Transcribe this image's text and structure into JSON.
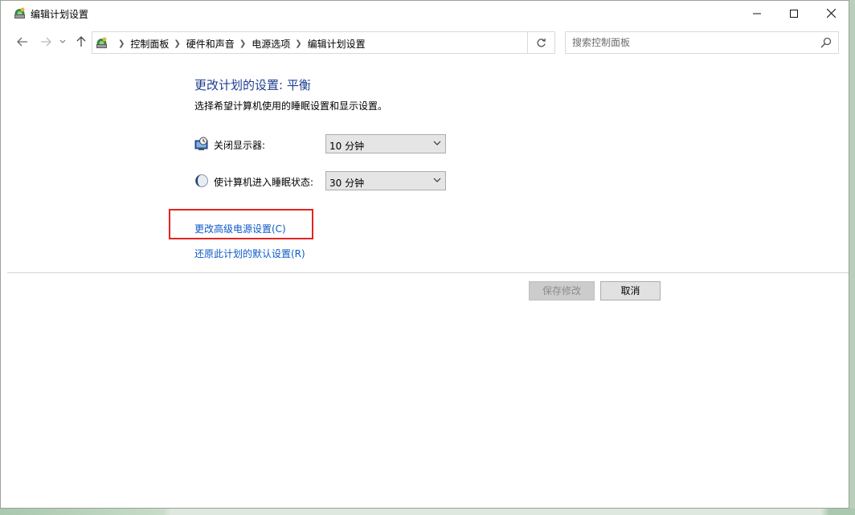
{
  "window": {
    "title": "编辑计划设置",
    "controls": {
      "minimize": "—",
      "maximize": "☐",
      "close": "✕"
    }
  },
  "navigation": {
    "back_icon": "arrow-left-icon",
    "forward_icon": "arrow-right-icon",
    "recent_icon": "chevron-down-icon",
    "up_icon": "arrow-up-icon",
    "breadcrumbs": [
      "控制面板",
      "硬件和声音",
      "电源选项",
      "编辑计划设置"
    ],
    "search_placeholder": "搜索控制面板"
  },
  "content": {
    "heading": "更改计划的设置: 平衡",
    "subtext": "选择希望计算机使用的睡眠设置和显示设置。",
    "settings": [
      {
        "label": "关闭显示器:",
        "value": "10 分钟",
        "icon": "display-timer-icon"
      },
      {
        "label": "使计算机进入睡眠状态:",
        "value": "30 分钟",
        "icon": "moon-sleep-icon"
      }
    ],
    "links": {
      "advanced": "更改高级电源设置(C)",
      "restore": "还原此计划的默认设置(R)"
    },
    "buttons": {
      "save": "保存修改",
      "cancel": "取消"
    }
  },
  "colors": {
    "heading": "#1e3d8f",
    "link": "#0b5ac9",
    "highlight": "#e32421"
  }
}
